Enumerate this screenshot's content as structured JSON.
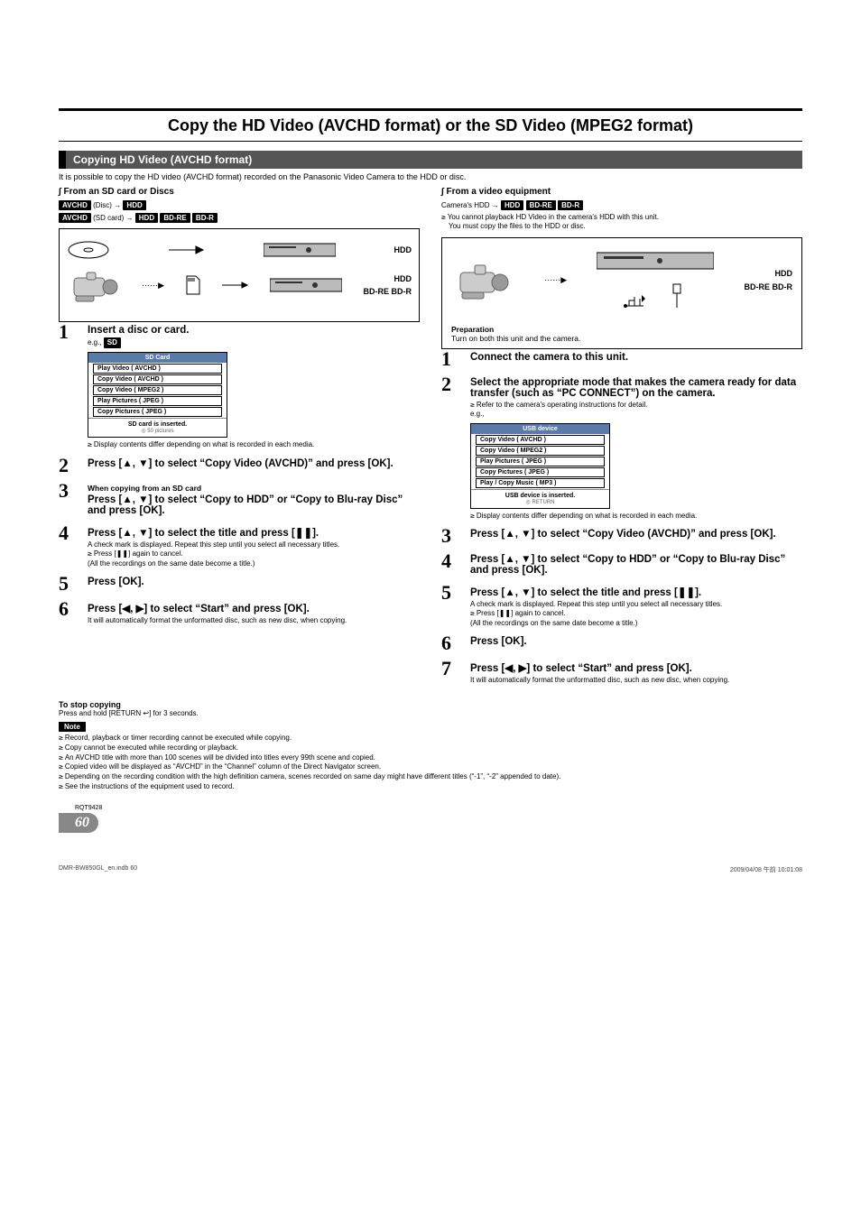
{
  "title": "Copy the HD Video (AVCHD format) or the SD Video (MPEG2 format)",
  "section_bar": "Copying HD Video (AVCHD format)",
  "intro": "It is possible to copy the HD video (AVCHD format) recorded on the Panasonic Video Camera to the HDD or disc.",
  "left": {
    "subhead": "∫ From an SD card or Discs",
    "flow1_pre": "AVCHD",
    "flow1_mid": " (Disc) → ",
    "flow1_d1": "HDD",
    "flow2_pre": "AVCHD",
    "flow2_mid": " (SD card) → ",
    "flow2_d1": "HDD",
    "flow2_d2": "BD-RE",
    "flow2_d3": "BD-R",
    "dest1": "HDD",
    "dest2": "HDD",
    "dest3": "BD-RE  BD-R",
    "step1": {
      "title": "Insert a disc or card.",
      "eg": "e.g., ",
      "eg_badge": "SD",
      "menu_title": "SD Card",
      "menu_items": [
        "Play Video ( AVCHD )",
        "Copy Video ( AVCHD )",
        "Copy Video ( MPEG2 )",
        "Play Pictures ( JPEG )",
        "Copy Pictures ( JPEG )"
      ],
      "menu_foot": "SD card is inserted.",
      "menu_pics": "50 pictures",
      "note": "Display contents differ depending on what is recorded in each media."
    },
    "step2": "Press [▲, ▼] to select “Copy Video (AVCHD)” and press [OK].",
    "step3_note": "When copying from an SD card",
    "step3": "Press [▲, ▼] to select “Copy to HDD” or “Copy to Blu-ray Disc” and press [OK].",
    "step4": "Press [▲, ▼] to select the title and press [❚❚].",
    "step4_sub1": "A check mark is displayed. Repeat this step until you select all necessary titles.",
    "step4_sub2": "Press [❚❚] again to cancel.",
    "step4_sub3": "(All the recordings on the same date become a title.)",
    "step5": "Press [OK].",
    "step6": "Press [◀, ▶] to select “Start” and press [OK].",
    "step6_sub": "It will automatically format the unformatted disc, such as new disc, when copying."
  },
  "right": {
    "subhead": "∫ From a video equipment",
    "flow_pre": "Camera's HDD → ",
    "flow_d1": "HDD",
    "flow_d2": "BD-RE",
    "flow_d3": "BD-R",
    "flow_note1": "You cannot playback HD Video in the camera's HDD with this unit.",
    "flow_note2": "You must copy the files to the HDD or disc.",
    "dest1": "HDD",
    "dest2": "BD-RE  BD-R",
    "prep_label": "Preparation",
    "prep_text": "Turn on both this unit and the camera.",
    "step1": "Connect the camera to this unit.",
    "step2": "Select the appropriate mode that makes the camera ready for data transfer (such as “PC CONNECT”) on the camera.",
    "step2_sub": "Refer to the camera's operating instructions for detail.",
    "step2_eg": "e.g.,",
    "menu_title": "USB device",
    "menu_items": [
      "Copy Video ( AVCHD )",
      "Copy Video ( MPEG2 )",
      "Play Pictures ( JPEG )",
      "Copy Pictures ( JPEG )",
      "Play / Copy Music ( MP3 )"
    ],
    "menu_foot": "USB device is inserted.",
    "menu_pics": "RETURN",
    "menu_note": "Display contents differ depending on what is recorded in each media.",
    "step3": "Press [▲, ▼] to select “Copy Video (AVCHD)” and press [OK].",
    "step4": "Press [▲, ▼] to select “Copy to HDD” or “Copy to Blu-ray Disc” and press [OK].",
    "step5": "Press [▲, ▼] to select the title and press [❚❚].",
    "step5_sub1": "A check mark is displayed. Repeat this step until you select all necessary titles.",
    "step5_sub2": "Press [❚❚] again to cancel.",
    "step5_sub3": "(All the recordings on the same date become a title.)",
    "step6": "Press [OK].",
    "step7": "Press [◀, ▶] to select “Start” and press [OK].",
    "step7_sub": "It will automatically format the unformatted disc, such as new disc, when copying."
  },
  "stop": {
    "title": "To stop copying",
    "text": "Press and hold [RETURN ↩] for 3 seconds."
  },
  "notes_label": "Note",
  "notes": [
    "Record, playback or timer recording cannot be executed while copying.",
    "Copy cannot be executed while recording or playback.",
    "An AVCHD title with more than 100 scenes will be divided into titles every 99th scene and copied.",
    "Copied video will be displayed as “AVCHD” in the “Channel” column of the Direct Navigator screen.",
    "Depending on the recording condition with the high definition camera, scenes recorded on same day might have different titles (“-1”, “-2” appended to date).",
    "See the instructions of the equipment used to record."
  ],
  "rqt": "RQT9428",
  "page_num": "60",
  "indd_left": "DMR-BW850GL_en.indb   60",
  "indd_right": "2009/04/08   午前 10:01:08"
}
